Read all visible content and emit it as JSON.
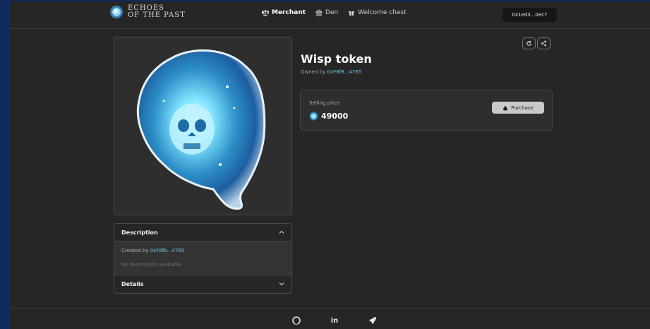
{
  "header": {
    "logo_line1": "ECHOES",
    "logo_line2": "OF THE PAST",
    "nav": [
      {
        "label": "Merchant",
        "icon": "scale-icon",
        "active": true
      },
      {
        "label": "Den",
        "icon": "bank-icon",
        "active": false
      },
      {
        "label": "Welcome chest",
        "icon": "gift-icon",
        "active": false
      }
    ],
    "wallet": "0x1ed3...0ec7"
  },
  "item": {
    "title": "Wisp token",
    "owned_prefix": "Owned by",
    "owner": "0xF8fB...4765",
    "image_icon": "ghost-skull-wisp-image"
  },
  "price": {
    "label": "Selling price",
    "value": "49000",
    "purchase_label": "Purchase"
  },
  "accordion": {
    "description_title": "Description",
    "created_prefix": "Created by",
    "creator": "0xF8fb...4765",
    "no_description": "No description available",
    "details_title": "Details"
  },
  "footer": {
    "linkedin": "in"
  },
  "colors": {
    "accent": "#6cc8ea",
    "background": "#262626",
    "outer": "#0f2a5c"
  }
}
